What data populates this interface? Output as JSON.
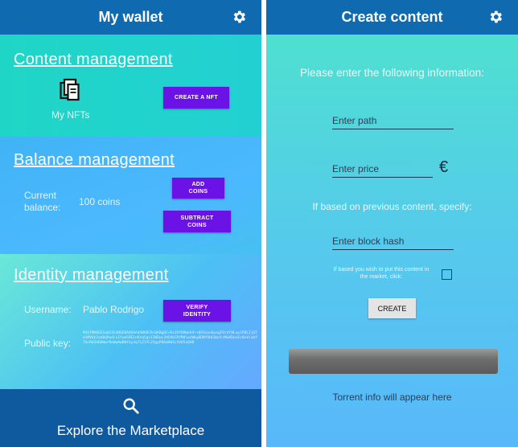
{
  "left": {
    "title": "My wallet",
    "content_section": {
      "title": "Content management",
      "my_nfts_label": "My NFTs",
      "create_nft_button": "CREATE A NFT"
    },
    "balance_section": {
      "title": "Balance management",
      "current_balance_label": "Current\nbalance:",
      "balance_value": "100 coins",
      "add_coins_button": "ADD\nCOINS",
      "subtract_coins_button": "SUBTRACT\nCOINS"
    },
    "identity_section": {
      "title": "Identity management",
      "username_label": "Username:",
      "username_value": "Pablo Rodrigo",
      "verify_button": "VERIFY\nIDENTITY",
      "public_key_label": "Public key:",
      "public_key_value": "MIGfMA0GCSqGSIb3DQEBAQUAA4GNADCBiQKBgQC+RzJOfhMwbV4r+Q5Vyoo6yegFUr4f8Lup1PBLIjGTdiMVUz2xk8qPwd/u1YumSHE1nRzq5gv1IWDwcJHCHbCRfMdlwzWkg0DNfOHLUmztsMwHDnxEc0eV/ubf7G+Rd2H6kWwrReWwAwB0tSy3q7LZ1YL25gyPQ6dAWIctDd5xQAB"
    },
    "footer": {
      "label": "Explore the Marketplace"
    }
  },
  "right": {
    "title": "Create content",
    "prompt": "Please enter the following information:",
    "path_placeholder": "Enter path",
    "price_placeholder": "Enter price",
    "currency_symbol": "€",
    "previous_content_prompt": "If based on previous content, specify:",
    "block_hash_placeholder": "Enter block hash",
    "market_checkbox_label": "If based you wish to put this content in the market, click:",
    "create_button": "CREATE",
    "progress_fraction": 1.0,
    "torrent_info": "Torrent info will appear here"
  },
  "icons": [
    "gear-icon",
    "nft-icon",
    "search-icon"
  ]
}
